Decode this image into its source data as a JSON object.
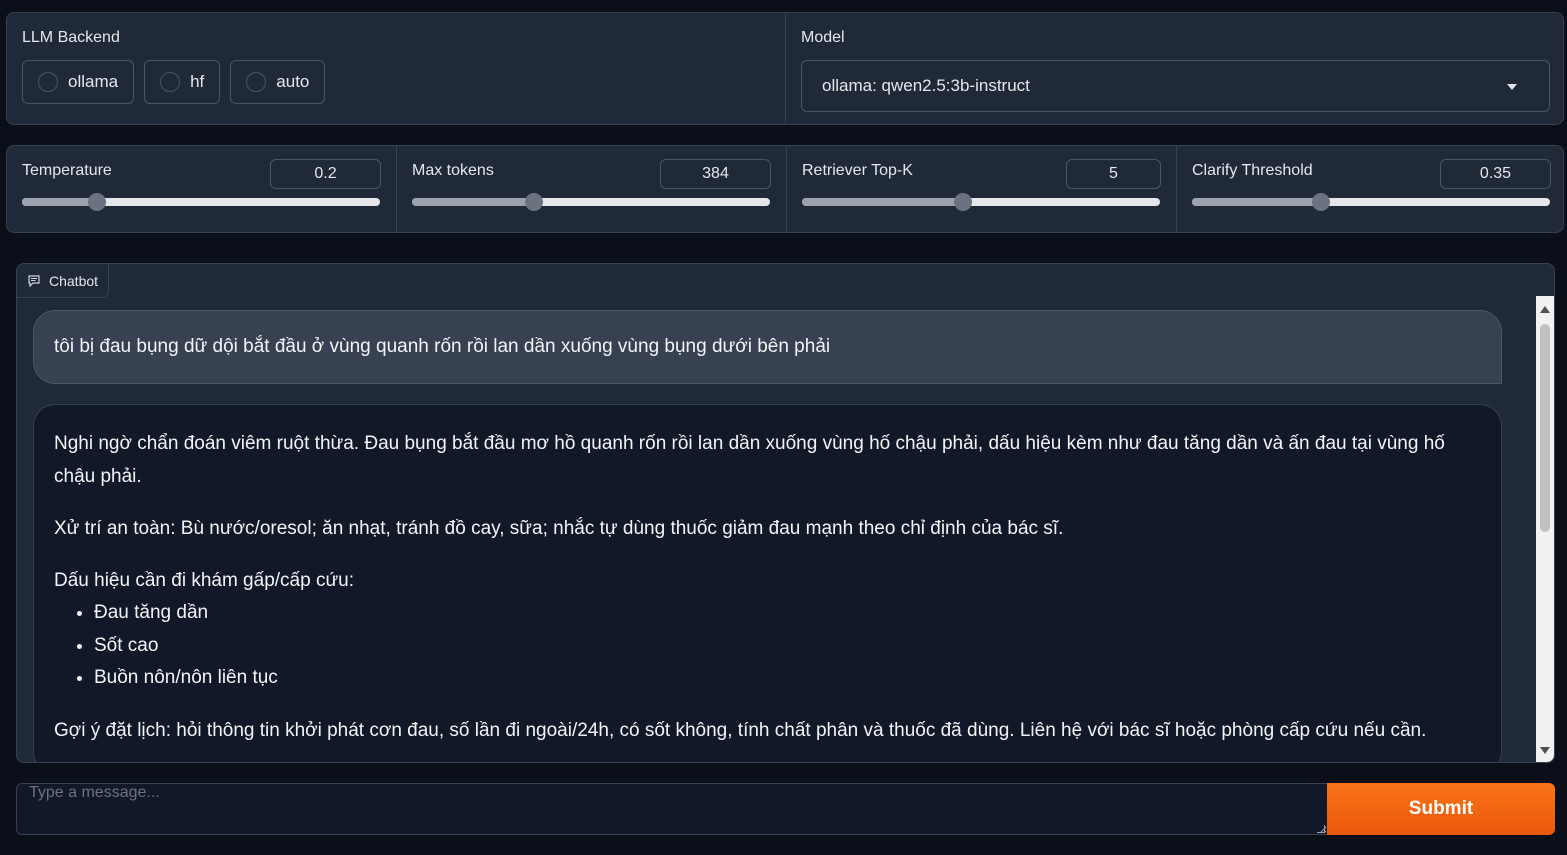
{
  "backend": {
    "label": "LLM Backend",
    "options": [
      "ollama",
      "hf",
      "auto"
    ]
  },
  "model": {
    "label": "Model",
    "selected": "ollama: qwen2.5:3b-instruct"
  },
  "sliders": [
    {
      "label": "Temperature",
      "value": "0.2",
      "fraction": 0.21
    },
    {
      "label": "Max tokens",
      "value": "384",
      "fraction": 0.34
    },
    {
      "label": "Retriever Top-K",
      "value": "5",
      "fraction": 0.45
    },
    {
      "label": "Clarify Threshold",
      "value": "0.35",
      "fraction": 0.36
    }
  ],
  "chatbot": {
    "tab_label": "Chatbot",
    "user_message": "tôi bị đau bụng dữ dội bắt đầu ở vùng quanh rốn rồi lan dần xuống vùng bụng dưới bên phải",
    "bot_message": {
      "p1": "Nghi ngờ chẩn đoán viêm ruột thừa. Đau bụng bắt đầu mơ hồ quanh rốn rồi lan dần xuống vùng hố chậu phải, dấu hiệu kèm như đau tăng dần và ấn đau tại vùng hố chậu phải.",
      "p2": "Xử trí an toàn: Bù nước/oresol; ăn nhạt, tránh đồ cay, sữa; nhắc tự dùng thuốc giảm đau mạnh theo chỉ định của bác sĩ.",
      "p3": "Dấu hiệu cần đi khám gấp/cấp cứu:",
      "bullets": [
        "Đau tăng dần",
        "Sốt cao",
        "Buồn nôn/nôn liên tục"
      ],
      "p4": "Gợi ý đặt lịch: hỏi thông tin khởi phát cơn đau, số lần đi ngoài/24h, có sốt không, tính chất phân và thuốc đã dùng. Liên hệ với bác sĩ hoặc phòng cấp cứu nếu cần."
    }
  },
  "input": {
    "placeholder": "Type a message...",
    "submit_label": "Submit"
  },
  "colors": {
    "background": "#0b0f19",
    "panel": "#1f2937",
    "accent": "#f97316"
  }
}
